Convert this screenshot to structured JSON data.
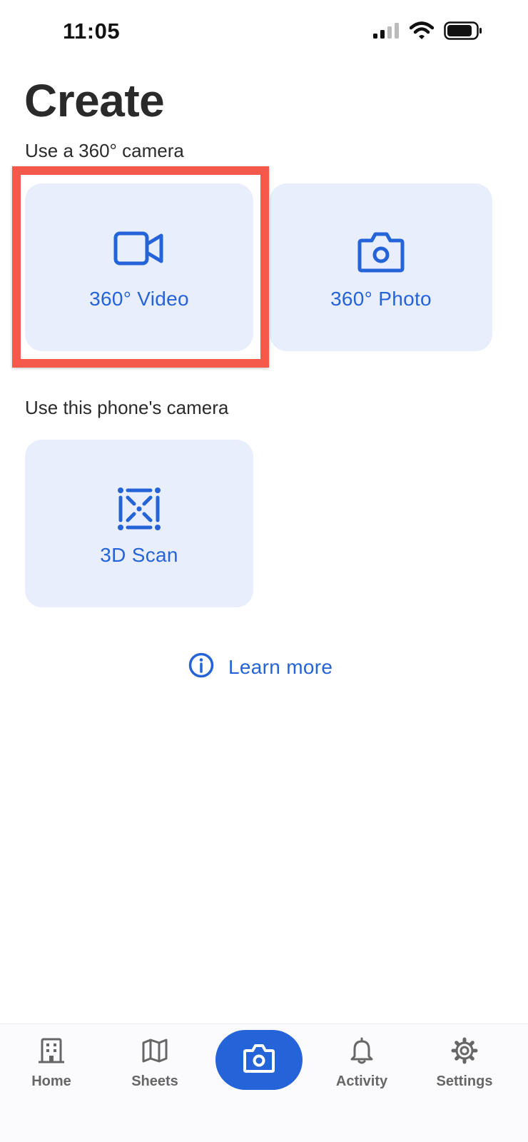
{
  "status_bar": {
    "time": "11:05",
    "icons": [
      "cellular-signal-icon",
      "wifi-icon",
      "battery-icon"
    ]
  },
  "page": {
    "title": "Create"
  },
  "sections": [
    {
      "label": "Use a 360° camera",
      "tiles": [
        {
          "label": "360° Video",
          "icon": "video-camera-icon"
        },
        {
          "label": "360° Photo",
          "icon": "camera-icon"
        }
      ]
    },
    {
      "label": "Use this phone's camera",
      "tiles": [
        {
          "label": "3D Scan",
          "icon": "3d-scan-icon"
        }
      ]
    }
  ],
  "learn_more": {
    "label": "Learn more",
    "icon": "info-icon"
  },
  "bottom_nav": {
    "items": [
      {
        "label": "Home",
        "icon": "building-icon"
      },
      {
        "label": "Sheets",
        "icon": "map-icon"
      },
      {
        "label": "",
        "icon": "camera-icon",
        "active": true
      },
      {
        "label": "Activity",
        "icon": "bell-icon"
      },
      {
        "label": "Settings",
        "icon": "gear-icon"
      }
    ]
  },
  "colors": {
    "accent": "#2563d9",
    "tile_background": "#e8eefb",
    "highlight": "#f4594c",
    "nav_text": "#666666"
  }
}
